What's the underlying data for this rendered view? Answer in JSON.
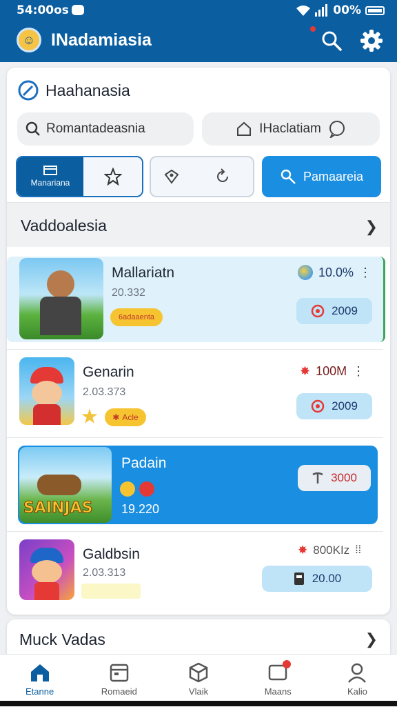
{
  "status": {
    "time": "54:00os",
    "battery": "00%"
  },
  "app": {
    "title": "INadamiasia"
  },
  "header": {
    "title": "Haahanasia"
  },
  "search": {
    "left_text": "Romantadeasnia",
    "right_text": "IHaclatiam"
  },
  "tabs": {
    "left_selected_label": "Manariana",
    "action_label": "Pamaareia"
  },
  "section1": {
    "title": "Vaddoalesia"
  },
  "games": [
    {
      "name": "Mallariatn",
      "sub": "20.332",
      "stat": "10.0%",
      "chip": "2009",
      "badge": "6adaaenta",
      "badge_color": "#f7c431"
    },
    {
      "name": "Genarin",
      "sub": "2.03.373",
      "stat": "100M",
      "chip": "2009",
      "badge": "Acle"
    },
    {
      "name": "Padain",
      "sub": "19.220",
      "stat": "3000",
      "banner": "SAINJAS"
    },
    {
      "name": "Galdbsin",
      "sub": "2.03.313",
      "stat": "800KIz",
      "chip": "20.00"
    }
  ],
  "section2": {
    "title": "Muck Vadas"
  },
  "nav": [
    {
      "label": "Etanne",
      "icon": "home-icon"
    },
    {
      "label": "Romaeid",
      "icon": "calendar-icon"
    },
    {
      "label": "Vlaik",
      "icon": "box-icon"
    },
    {
      "label": "Maans",
      "icon": "message-icon"
    },
    {
      "label": "Kalio",
      "icon": "profile-icon"
    }
  ],
  "colors": {
    "primary": "#0b5ea0",
    "accent": "#1a8ee0",
    "chip": "#bfe3f7",
    "highlight_row": "#dff2fb"
  }
}
